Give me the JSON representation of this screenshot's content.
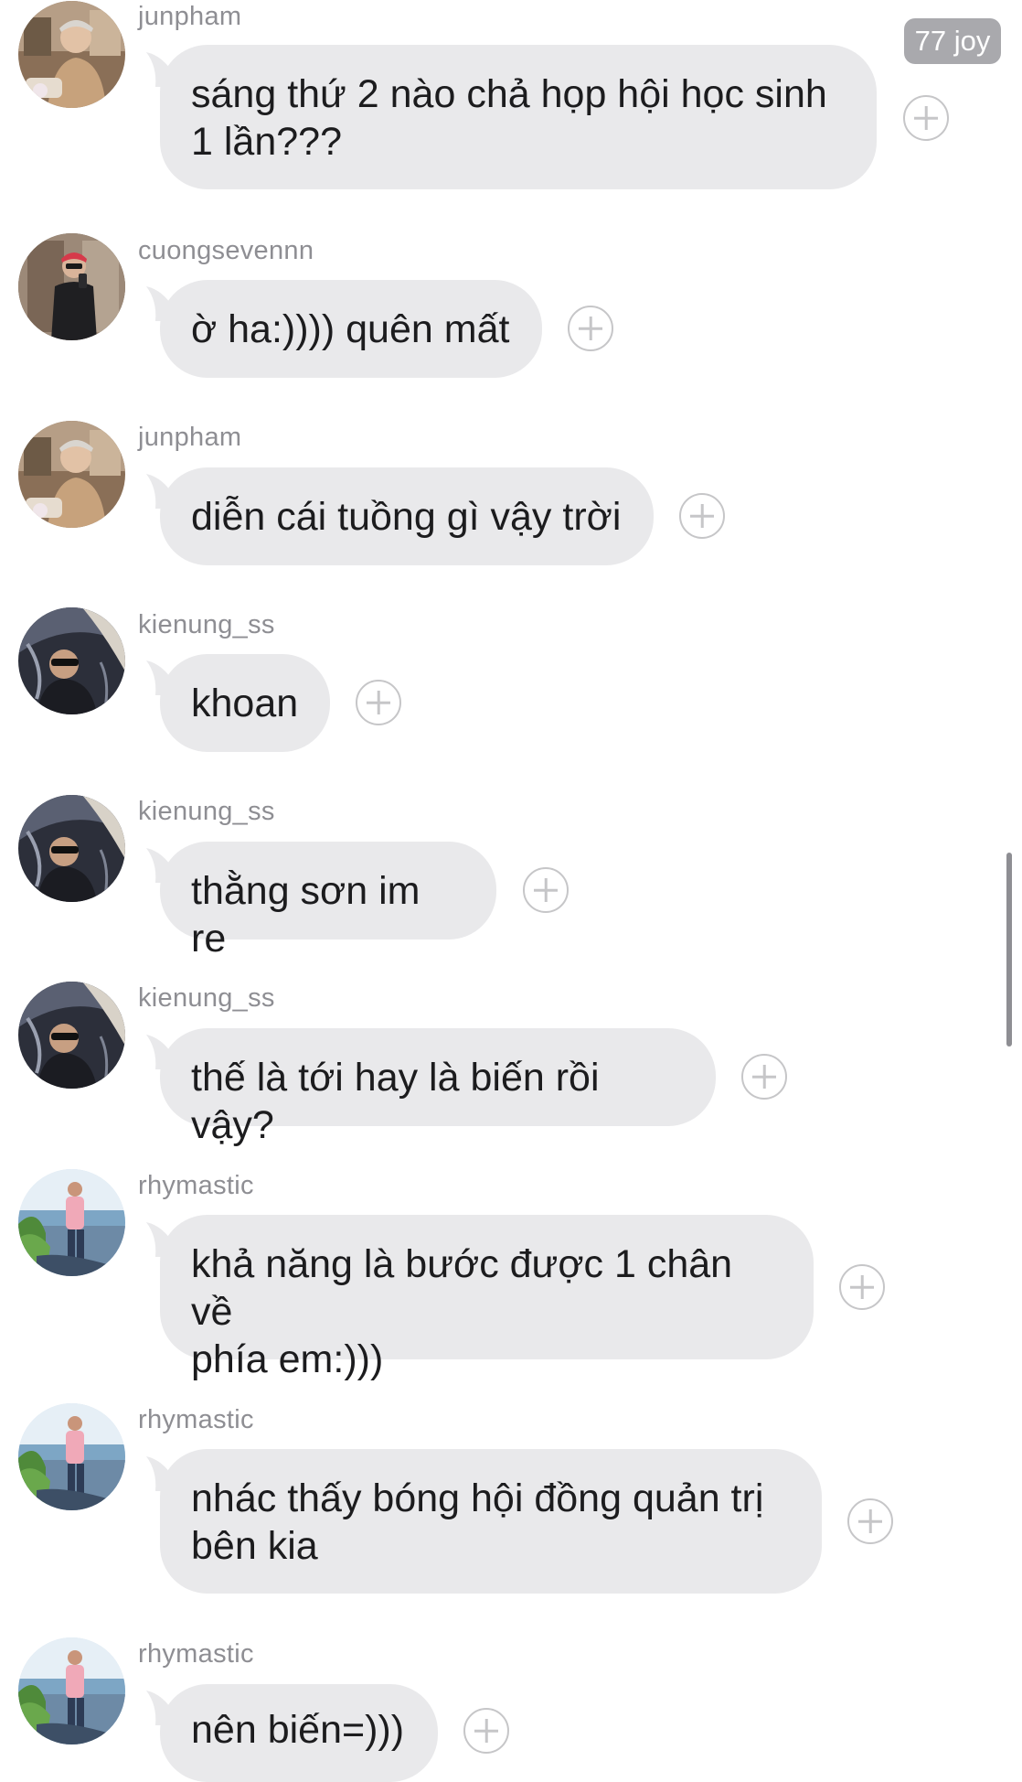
{
  "colors": {
    "bubble": "#e9e9eb",
    "username": "#8e8e93",
    "text": "#1c1c1e",
    "badge": "#a9a9ad"
  },
  "reaction_badge": {
    "label": "77 joy"
  },
  "messages": [
    {
      "user": "junpham",
      "text": "sáng thứ 2 nào chả họp hội học sinh\n1 lần???",
      "avatar_icon": "avatar-junpham"
    },
    {
      "user": "cuongsevennn",
      "text": "ờ ha:)))) quên mất",
      "avatar_icon": "avatar-cuongsevennn"
    },
    {
      "user": "junpham",
      "text": "diễn cái tuồng gì vậy trời",
      "avatar_icon": "avatar-junpham"
    },
    {
      "user": "kienung_ss",
      "text": "khoan",
      "avatar_icon": "avatar-kienung"
    },
    {
      "user": "kienung_ss",
      "text": "thằng sơn im re",
      "avatar_icon": "avatar-kienung"
    },
    {
      "user": "kienung_ss",
      "text": "thế là tới hay là biến rồi vậy?",
      "avatar_icon": "avatar-kienung"
    },
    {
      "user": "rhymastic",
      "text": "khả năng là bước được 1 chân về\nphía em:)))",
      "avatar_icon": "avatar-rhymastic"
    },
    {
      "user": "rhymastic",
      "text": "nhác thấy bóng hội đồng quản trị\nbên kia",
      "avatar_icon": "avatar-rhymastic"
    },
    {
      "user": "rhymastic",
      "text": "nên biến=)))",
      "avatar_icon": "avatar-rhymastic"
    }
  ]
}
